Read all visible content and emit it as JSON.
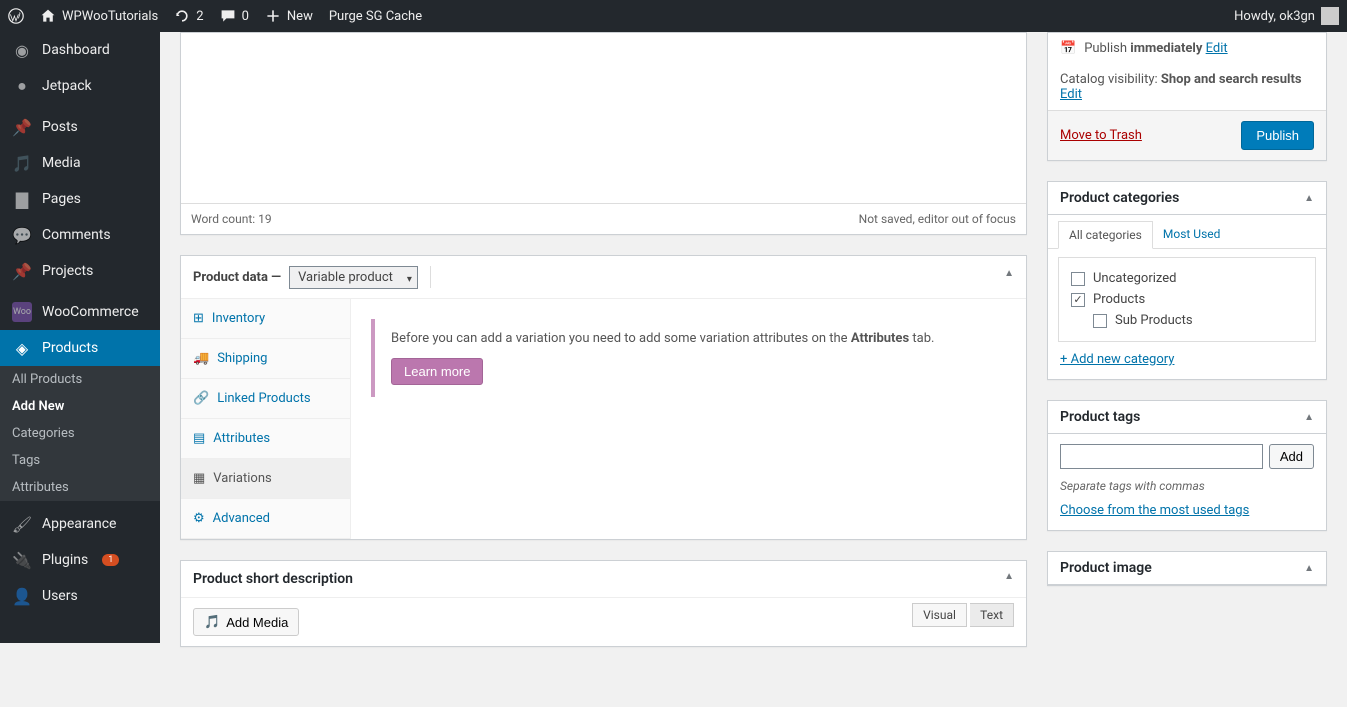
{
  "adminbar": {
    "site_name": "WPWooTutorials",
    "updates_count": "2",
    "comments_count": "0",
    "new_label": "New",
    "purge_label": "Purge SG Cache",
    "howdy": "Howdy, ok3gn"
  },
  "sidebar": {
    "items": [
      {
        "label": "Dashboard",
        "icon": "dashboard"
      },
      {
        "label": "Jetpack",
        "icon": "jetpack"
      },
      {
        "label": "Posts",
        "icon": "pin"
      },
      {
        "label": "Media",
        "icon": "media"
      },
      {
        "label": "Pages",
        "icon": "page"
      },
      {
        "label": "Comments",
        "icon": "comment"
      },
      {
        "label": "Projects",
        "icon": "pin"
      },
      {
        "label": "WooCommerce",
        "icon": "woo"
      },
      {
        "label": "Products",
        "icon": "product",
        "current": true
      },
      {
        "label": "Appearance",
        "icon": "brush"
      },
      {
        "label": "Plugins",
        "icon": "plug",
        "badge": "1"
      },
      {
        "label": "Users",
        "icon": "user"
      }
    ],
    "submenu": [
      {
        "label": "All Products"
      },
      {
        "label": "Add New",
        "current": true
      },
      {
        "label": "Categories"
      },
      {
        "label": "Tags"
      },
      {
        "label": "Attributes"
      }
    ]
  },
  "editor": {
    "word_count_label": "Word count: 19",
    "status_right": "Not saved, editor out of focus"
  },
  "product_data": {
    "title_prefix": "Product data —",
    "type": "Variable product",
    "tabs": [
      "Inventory",
      "Shipping",
      "Linked Products",
      "Attributes",
      "Variations",
      "Advanced"
    ],
    "active_tab": "Variations",
    "notice_text_before": "Before you can add a variation you need to add some variation attributes on the ",
    "notice_text_bold": "Attributes",
    "notice_text_after": " tab.",
    "learn_more": "Learn more"
  },
  "short_desc": {
    "title": "Product short description",
    "add_media": "Add Media",
    "tab_visual": "Visual",
    "tab_text": "Text"
  },
  "publish": {
    "publish_label_pre": "Publish ",
    "publish_label_bold": "immediately",
    "edit": "Edit",
    "catalog_pre": "Catalog visibility: ",
    "catalog_val": "Shop and search results",
    "trash": "Move to Trash",
    "publish_btn": "Publish"
  },
  "categories": {
    "title": "Product categories",
    "tab_all": "All categories",
    "tab_most": "Most Used",
    "items": [
      {
        "label": "Uncategorized",
        "checked": false
      },
      {
        "label": "Products",
        "checked": true
      },
      {
        "label": "Sub Products",
        "checked": false,
        "indent": true
      }
    ],
    "add_new": "+ Add new category"
  },
  "tags": {
    "title": "Product tags",
    "add": "Add",
    "hint": "Separate tags with commas",
    "choose": "Choose from the most used tags"
  },
  "product_image": {
    "title": "Product image"
  }
}
